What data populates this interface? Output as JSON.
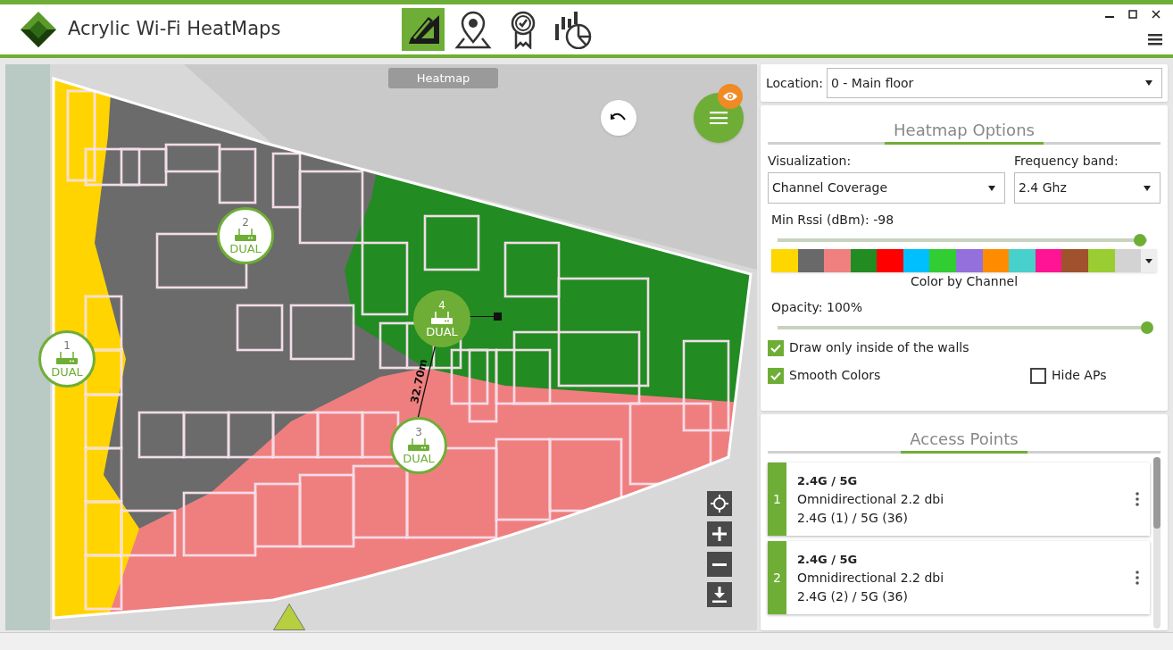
{
  "app": {
    "title": "Acrylic Wi-Fi HeatMaps"
  },
  "toolbar": [
    {
      "kind": "draw",
      "selected": true
    },
    {
      "kind": "location",
      "selected": false
    },
    {
      "kind": "certificate",
      "selected": false
    },
    {
      "kind": "report",
      "selected": false
    }
  ],
  "map": {
    "tab": "Heatmap",
    "access_points": [
      {
        "number": "1",
        "label": "DUAL",
        "selected": false
      },
      {
        "number": "2",
        "label": "DUAL",
        "selected": false
      },
      {
        "number": "3",
        "label": "DUAL",
        "selected": false
      },
      {
        "number": "4",
        "label": "DUAL",
        "selected": true
      }
    ],
    "measurement": "32.70m"
  },
  "location": {
    "label": "Location:",
    "value": "0 - Main floor"
  },
  "heatmap_options": {
    "title": "Heatmap Options",
    "visualization": {
      "label": "Visualization:",
      "value": "Channel Coverage"
    },
    "frequency_band": {
      "label": "Frequency band:",
      "value": "2.4 Ghz"
    },
    "min_rssi": {
      "label": "Min Rssi (dBm): -98",
      "level": 0.98
    },
    "palette": [
      {
        "color": "#ffd700"
      },
      {
        "color": "#696969"
      },
      {
        "color": "#f08080"
      },
      {
        "color": "#228b22"
      },
      {
        "color": "#ff0000"
      },
      {
        "color": "#00bfff"
      },
      {
        "color": "#32cd32"
      },
      {
        "color": "#9370db"
      },
      {
        "color": "#ff8c00"
      },
      {
        "color": "#48d1cc"
      },
      {
        "color": "#ff1493"
      },
      {
        "color": "#a0522d"
      },
      {
        "color": "#9acd32"
      },
      {
        "color": "#d3d3d3"
      }
    ],
    "palette_label": "Color by Channel",
    "opacity": {
      "label": "Opacity: 100%",
      "level": 1.0
    },
    "checkboxes": [
      {
        "label": "Draw only inside of the walls",
        "checked": true
      },
      {
        "label": "Smooth Colors",
        "checked": true
      },
      {
        "label": "Hide APs",
        "checked": false
      }
    ]
  },
  "access_points": {
    "title": "Access Points",
    "items": [
      {
        "number": "1",
        "bands": "2.4G / 5G",
        "antenna": "Omnidirectional 2.2 dbi",
        "channels": "2.4G (1) / 5G (36)"
      },
      {
        "number": "2",
        "bands": "2.4G / 5G",
        "antenna": "Omnidirectional 2.2 dbi",
        "channels": "2.4G (2) / 5G (36)"
      }
    ]
  }
}
